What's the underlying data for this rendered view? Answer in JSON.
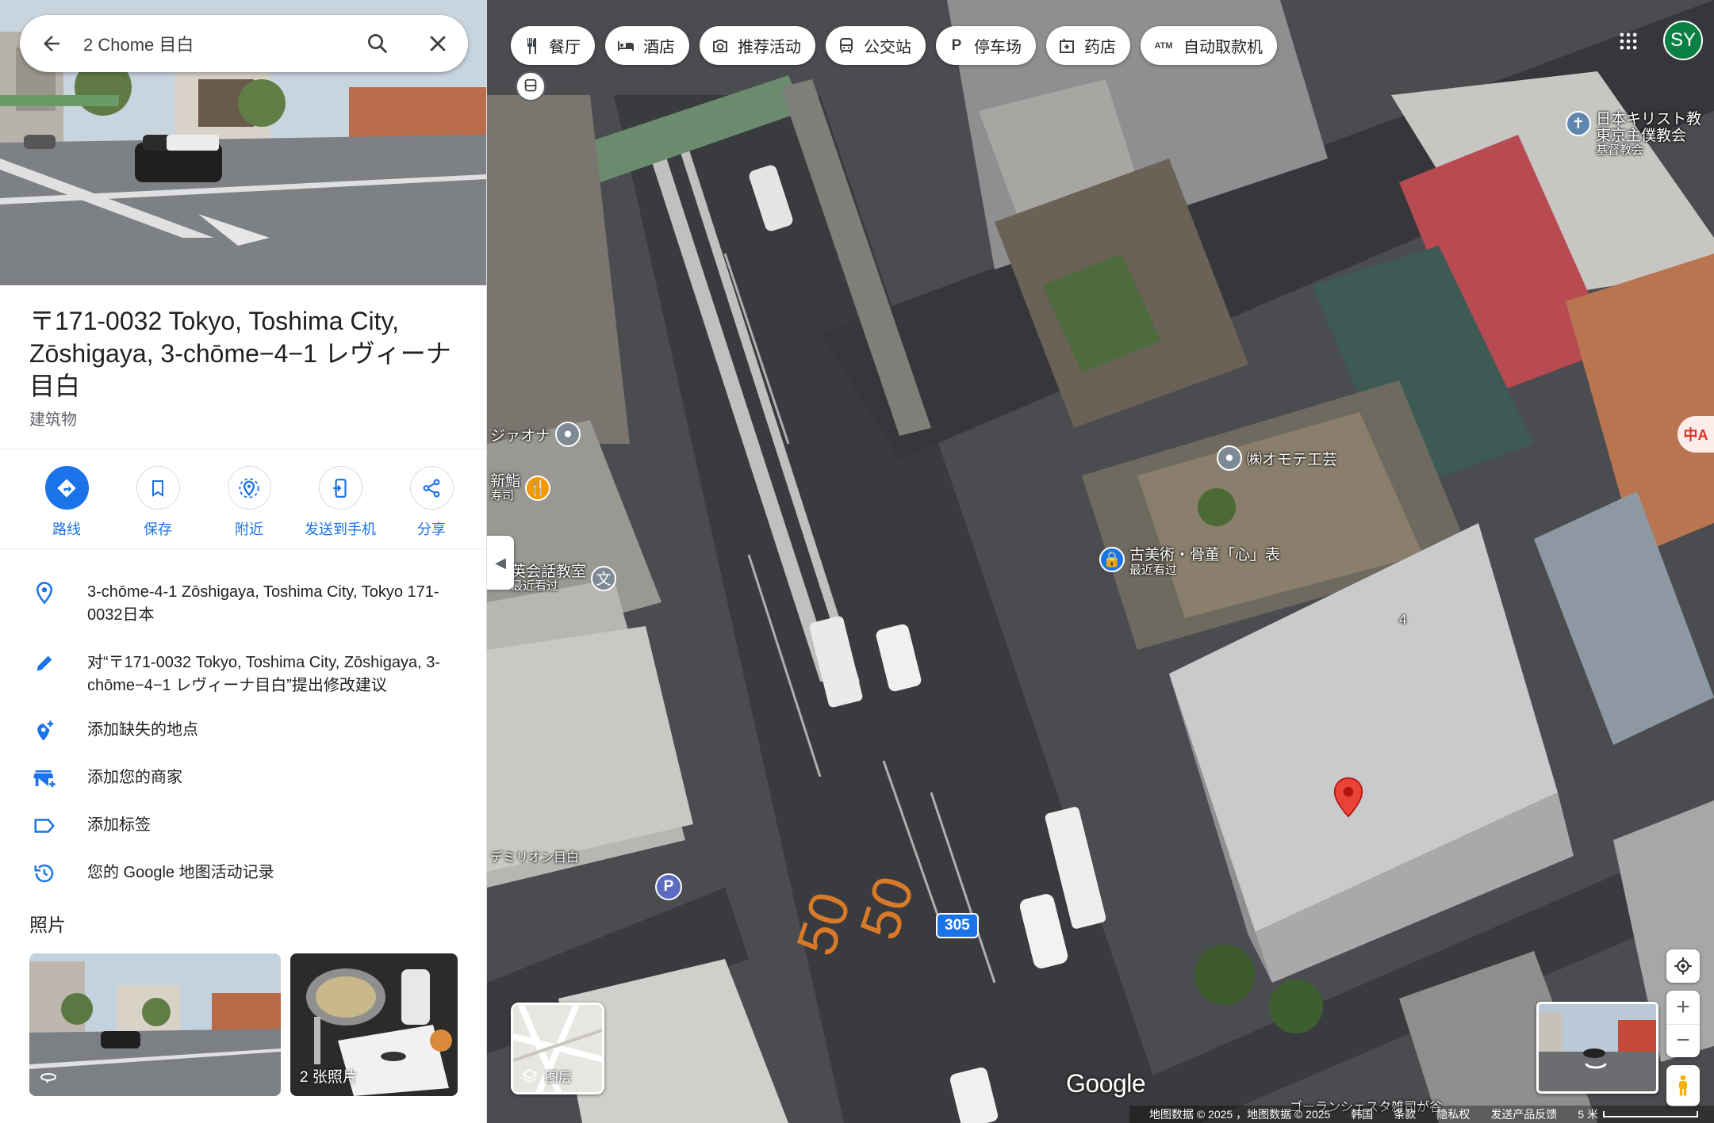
{
  "search": {
    "query": "2 Chome 目白"
  },
  "place": {
    "title": "〒171-0032 Tokyo, Toshima City, Zōshigaya, 3-chōme−4−1 レヴィーナ目白",
    "category": "建筑物"
  },
  "actions": [
    {
      "label": "路线",
      "icon": "directions-icon"
    },
    {
      "label": "保存",
      "icon": "bookmark-icon"
    },
    {
      "label": "附近",
      "icon": "nearby-icon"
    },
    {
      "label": "发送到手机",
      "icon": "send-to-phone-icon"
    },
    {
      "label": "分享",
      "icon": "share-icon"
    }
  ],
  "info": [
    {
      "text": "3-chōme-4-1 Zōshigaya, Toshima City, Tokyo 171-0032日本",
      "icon": "location-pin-icon"
    },
    {
      "text": "对“〒171-0032 Tokyo, Toshima City, Zōshigaya, 3-chōme−4−1 レヴィーナ目白”提出修改建议",
      "icon": "edit-pencil-icon"
    },
    {
      "text": "添加缺失的地点",
      "icon": "add-place-icon"
    },
    {
      "text": "添加您的商家",
      "icon": "add-business-icon"
    },
    {
      "text": "添加标签",
      "icon": "label-icon"
    },
    {
      "text": "您的 Google 地图活动记录",
      "icon": "history-icon"
    }
  ],
  "photos": {
    "heading": "照片",
    "second_caption": "2 张照片"
  },
  "chips": [
    {
      "label": "餐厅",
      "icon": "restaurant-icon"
    },
    {
      "label": "酒店",
      "icon": "hotel-icon"
    },
    {
      "label": "推荐活动",
      "icon": "camera-icon"
    },
    {
      "label": "公交站",
      "icon": "transit-icon"
    },
    {
      "label": "停车场",
      "icon": "parking-icon"
    },
    {
      "label": "药店",
      "icon": "pharmacy-icon"
    },
    {
      "label": "自动取款机",
      "icon": "atm-icon"
    }
  ],
  "user": {
    "initials": "SY"
  },
  "map": {
    "pois": {
      "church_line1": "日本キリスト教",
      "church_line2": "東京主僕教会",
      "church_line3": "基督教会",
      "omote": "㈱オモテ工芸",
      "antique": "古美術・骨董「心」表",
      "antique_sub": "最近看过",
      "sushi": "新鮨",
      "sushi_sub": "寿司",
      "jiaona": "ジァオナ",
      "english": "英会話教室",
      "english_sub": "最近看过",
      "demirion": "デミリオン目白",
      "bottom": "ゴーランシェスタ雑司が谷",
      "building_number": "4"
    },
    "road_label": "305",
    "google_logo": "Google",
    "layers_label": "图层",
    "translate_label": "中A"
  },
  "attribution": {
    "data": "地图数据 © 2025 ，地图数据 © 2025",
    "korea": "韩国",
    "terms": "条款",
    "privacy": "隐私权",
    "feedback": "发送产品反馈",
    "scale": "5 米"
  },
  "colors": {
    "accent": "#1a73e8",
    "avatar": "#0b8043",
    "marker": "#ea4335"
  }
}
